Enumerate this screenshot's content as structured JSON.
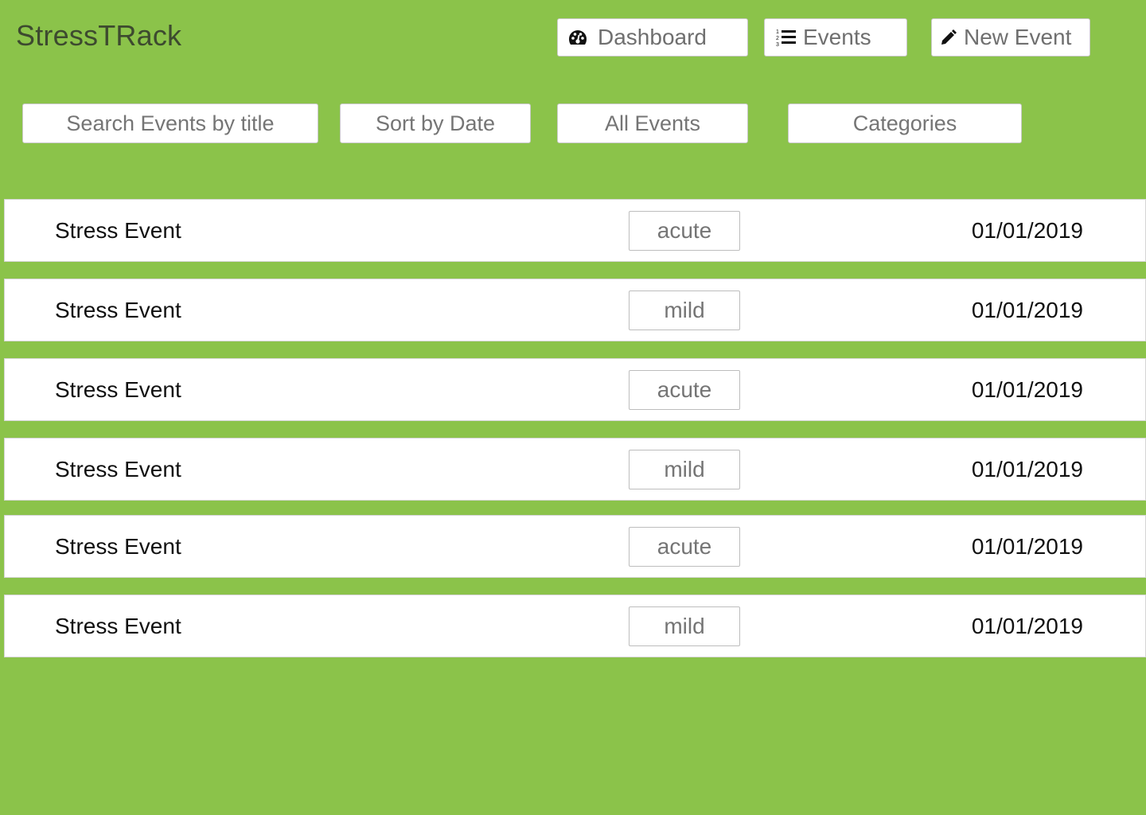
{
  "app": {
    "brand": "StressTRack"
  },
  "nav": {
    "dashboard": {
      "label": "Dashboard",
      "icon": "dashboard-gauge-icon"
    },
    "events": {
      "label": "Events",
      "icon": "numbered-list-icon"
    },
    "new_event": {
      "label": "New Event",
      "icon": "pencil-icon"
    }
  },
  "filters": {
    "search": "Search Events by title",
    "sort": "Sort by Date",
    "all_events": "All Events",
    "categories": "Categories"
  },
  "events": [
    {
      "title": "Stress Event",
      "severity": "acute",
      "date": "01/01/2019"
    },
    {
      "title": "Stress Event",
      "severity": "mild",
      "date": "01/01/2019"
    },
    {
      "title": "Stress Event",
      "severity": "acute",
      "date": "01/01/2019"
    },
    {
      "title": "Stress Event",
      "severity": "mild",
      "date": "01/01/2019"
    },
    {
      "title": "Stress Event",
      "severity": "acute",
      "date": "01/01/2019"
    },
    {
      "title": "Stress Event",
      "severity": "mild",
      "date": "01/01/2019"
    }
  ],
  "colors": {
    "background": "#8bc34a",
    "card": "#ffffff",
    "text": "#111111",
    "muted_text": "#757575"
  }
}
